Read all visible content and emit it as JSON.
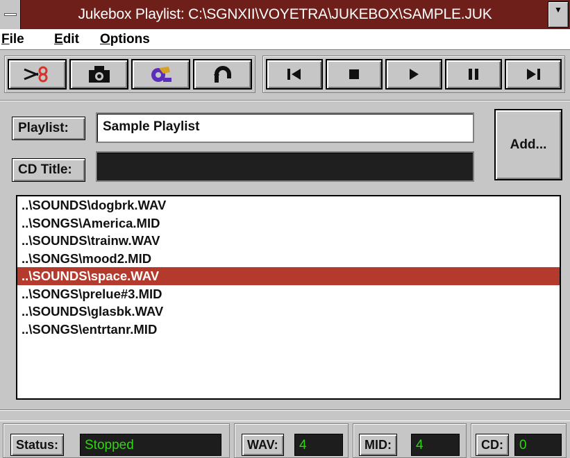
{
  "window": {
    "title": "Jukebox Playlist: C:\\SGNXII\\VOYETRA\\JUKEBOX\\SAMPLE.JUK",
    "dropdown_glyph": "▼"
  },
  "menu": [
    {
      "prefix": "",
      "accel": "F",
      "rest": "ile"
    },
    {
      "prefix": "",
      "accel": "E",
      "rest": "dit"
    },
    {
      "prefix": "",
      "accel": "O",
      "rest": "ptions"
    }
  ],
  "toolbar": {
    "edit_tools": [
      "cut-icon",
      "camera-icon",
      "tape-icon",
      "undo-icon"
    ],
    "transport": [
      "skip-back-icon",
      "stop-icon",
      "play-icon",
      "pause-icon",
      "skip-forward-icon"
    ]
  },
  "playlist": {
    "label": "Playlist:",
    "value": "Sample Playlist"
  },
  "cd": {
    "label": "CD Title:",
    "value": ""
  },
  "add_button": "Add...",
  "files": [
    "..\\SOUNDS\\dogbrk.WAV",
    "..\\SONGS\\America.MID",
    "..\\SOUNDS\\trainw.WAV",
    "..\\SONGS\\mood2.MID",
    "..\\SOUNDS\\space.WAV",
    "..\\SONGS\\prelue#3.MID",
    "..\\SOUNDS\\glasbk.WAV",
    "..\\SONGS\\entrtanr.MID"
  ],
  "selected_index": 4,
  "status": {
    "label": "Status:",
    "value": "Stopped",
    "wav_label": "WAV:",
    "wav_value": "4",
    "mid_label": "MID:",
    "mid_value": "4",
    "cd_label": "CD:",
    "cd_value": "0"
  },
  "colors": {
    "titlebar": "#6e1f1a",
    "selection": "#b33a2d",
    "status_text": "#2fd60f",
    "icon_red": "#d6342a",
    "icon_purple": "#5a2dbb"
  }
}
